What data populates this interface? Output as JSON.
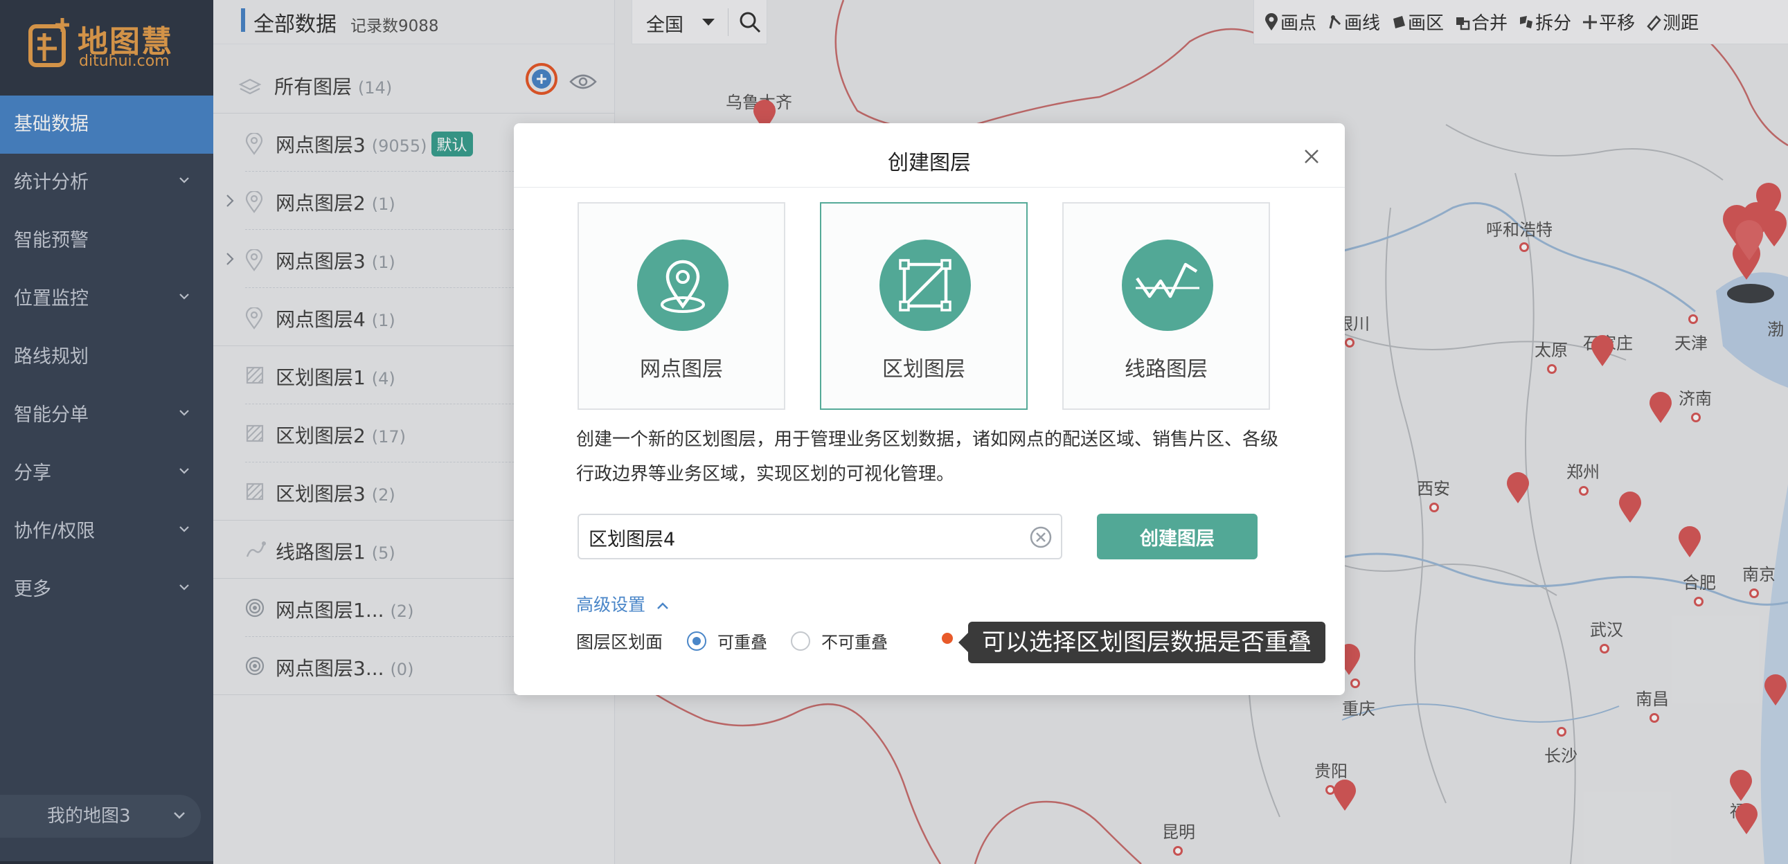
{
  "brand": {
    "name": "地图慧",
    "domain": "dituhui.com",
    "color": "#e5a04f"
  },
  "nav": {
    "items": [
      {
        "label": "基础数据",
        "active": true,
        "has_submenu": false
      },
      {
        "label": "统计分析",
        "active": false,
        "has_submenu": true
      },
      {
        "label": "智能预警",
        "active": false,
        "has_submenu": false
      },
      {
        "label": "位置监控",
        "active": false,
        "has_submenu": true
      },
      {
        "label": "路线规划",
        "active": false,
        "has_submenu": false
      },
      {
        "label": "智能分单",
        "active": false,
        "has_submenu": true
      },
      {
        "label": "分享",
        "active": false,
        "has_submenu": true
      },
      {
        "label": "协作/权限",
        "active": false,
        "has_submenu": true
      },
      {
        "label": "更多",
        "active": false,
        "has_submenu": true
      }
    ],
    "current_map": "我的地图3"
  },
  "panel": {
    "title": "全部数据",
    "record_count": "记录数9088",
    "all_layers": {
      "label": "所有图层",
      "count": "(14)"
    },
    "layers": [
      {
        "name": "网点图层3",
        "count": "(9055)",
        "badge": "默认",
        "icon": "map-pin-icon",
        "expandable": false
      },
      {
        "name": "网点图层2",
        "count": "(1)",
        "icon": "map-pin-icon",
        "expandable": true
      },
      {
        "name": "网点图层3",
        "count": "(1)",
        "icon": "map-pin-icon",
        "expandable": true
      },
      {
        "name": "网点图层4",
        "count": "(1)",
        "icon": "map-pin-icon",
        "expandable": false
      },
      {
        "name": "区划图层1",
        "count": "(4)",
        "icon": "region-icon",
        "expandable": false
      },
      {
        "name": "区划图层2",
        "count": "(17)",
        "icon": "region-icon",
        "expandable": false
      },
      {
        "name": "区划图层3",
        "count": "(2)",
        "icon": "region-icon",
        "expandable": false
      },
      {
        "name": "线路图层1",
        "count": "(5)",
        "icon": "route-icon",
        "expandable": false
      },
      {
        "name": "网点图层1...",
        "count": "(2)",
        "icon": "heat-icon",
        "expandable": false
      },
      {
        "name": "网点图层3...",
        "count": "(0)",
        "icon": "heat-icon",
        "expandable": false
      }
    ]
  },
  "map": {
    "region": "全国",
    "tools": [
      "画点",
      "画线",
      "画区",
      "合并",
      "拆分",
      "平移",
      "测距"
    ],
    "cities": [
      "乌鲁木齐",
      "呼和浩特",
      "银川",
      "太原",
      "石家庄",
      "天津",
      "渤",
      "济南",
      "郑州",
      "西安",
      "合肥",
      "南京",
      "武汉",
      "重庆",
      "南昌",
      "长沙",
      "贵阳",
      "昆明",
      "福"
    ]
  },
  "modal": {
    "title": "创建图层",
    "types": [
      {
        "label": "网点图层",
        "icon": "location-pin-icon",
        "selected": false
      },
      {
        "label": "区划图层",
        "icon": "polygon-icon",
        "selected": true
      },
      {
        "label": "线路图层",
        "icon": "route-line-icon",
        "selected": false
      }
    ],
    "description_line1": "创建一个新的区划图层，用于管理业务区划数据，诸如网点的配送区域、销售片区、各级",
    "description_line2": "行政边界等业务区域，实现区划的可视化管理。",
    "layer_name_value": "区划图层4",
    "create_button": "创建图层",
    "advanced_settings": "高级设置",
    "overlap_label": "图层区划面",
    "overlap_options": [
      {
        "label": "可重叠",
        "checked": true
      },
      {
        "label": "不可重叠",
        "checked": false
      }
    ],
    "tooltip": "可以选择区划图层数据是否重叠"
  },
  "colors": {
    "nav_bg": "#3c4758",
    "nav_active": "#4a86c8",
    "teal": "#52a896",
    "badge_teal": "#3aa090",
    "link_blue": "#4a86c8",
    "pin_red": "#d85a5a",
    "highlight_orange": "#e85a2a"
  }
}
